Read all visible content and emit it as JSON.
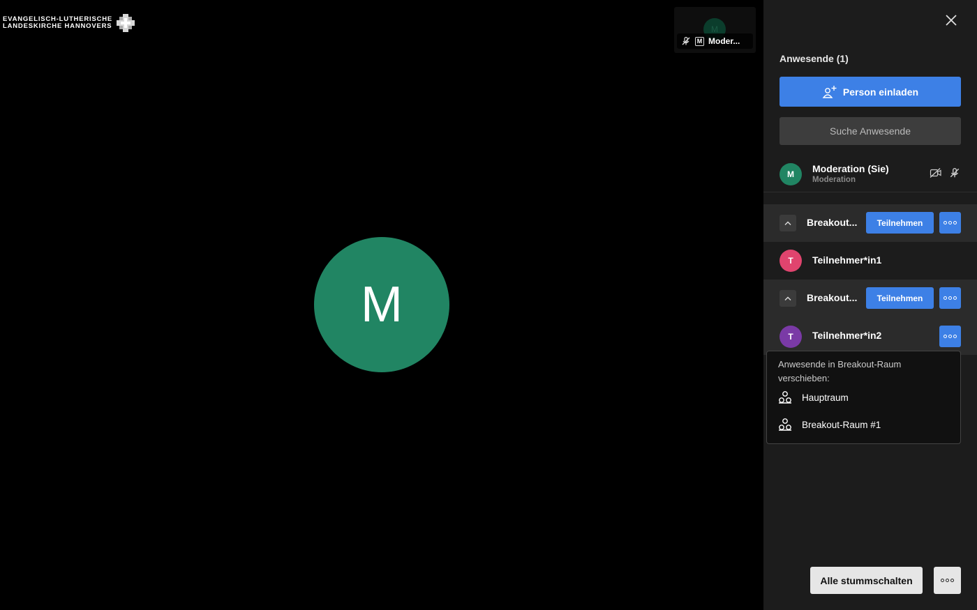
{
  "logo": {
    "line1": "EVANGELISCH-LUTHERISCHE",
    "line2": "LANDESKIRCHE HANNOVERS"
  },
  "thumbnail": {
    "initial": "M",
    "badge": "M",
    "name": "Moder..."
  },
  "main_avatar": {
    "initial": "M",
    "color": "#218563"
  },
  "panel": {
    "title": "Anwesende (1)",
    "invite_label": "Person einladen",
    "search_placeholder": "Suche Anwesende",
    "me": {
      "initial": "M",
      "name": "Moderation (Sie)",
      "role": "Moderation",
      "color": "#218563"
    },
    "rooms": [
      {
        "name": "Breakout...",
        "join_label": "Teilnehmen"
      },
      {
        "name": "Breakout...",
        "join_label": "Teilnehmen"
      }
    ],
    "participants": [
      {
        "initial": "T",
        "name": "Teilnehmer*in1",
        "color": "#e0446e"
      },
      {
        "initial": "T",
        "name": "Teilnehmer*in2",
        "color": "#7a3aa6"
      }
    ]
  },
  "move_menu": {
    "title": "Anwesende in Breakout-Raum verschieben:",
    "items": [
      "Hauptraum",
      "Breakout-Raum #1"
    ]
  },
  "footer": {
    "mute_all_label": "Alle stummschalten"
  },
  "colors": {
    "accent": "#3d80e6",
    "panel_bg": "#1c1c1c"
  }
}
